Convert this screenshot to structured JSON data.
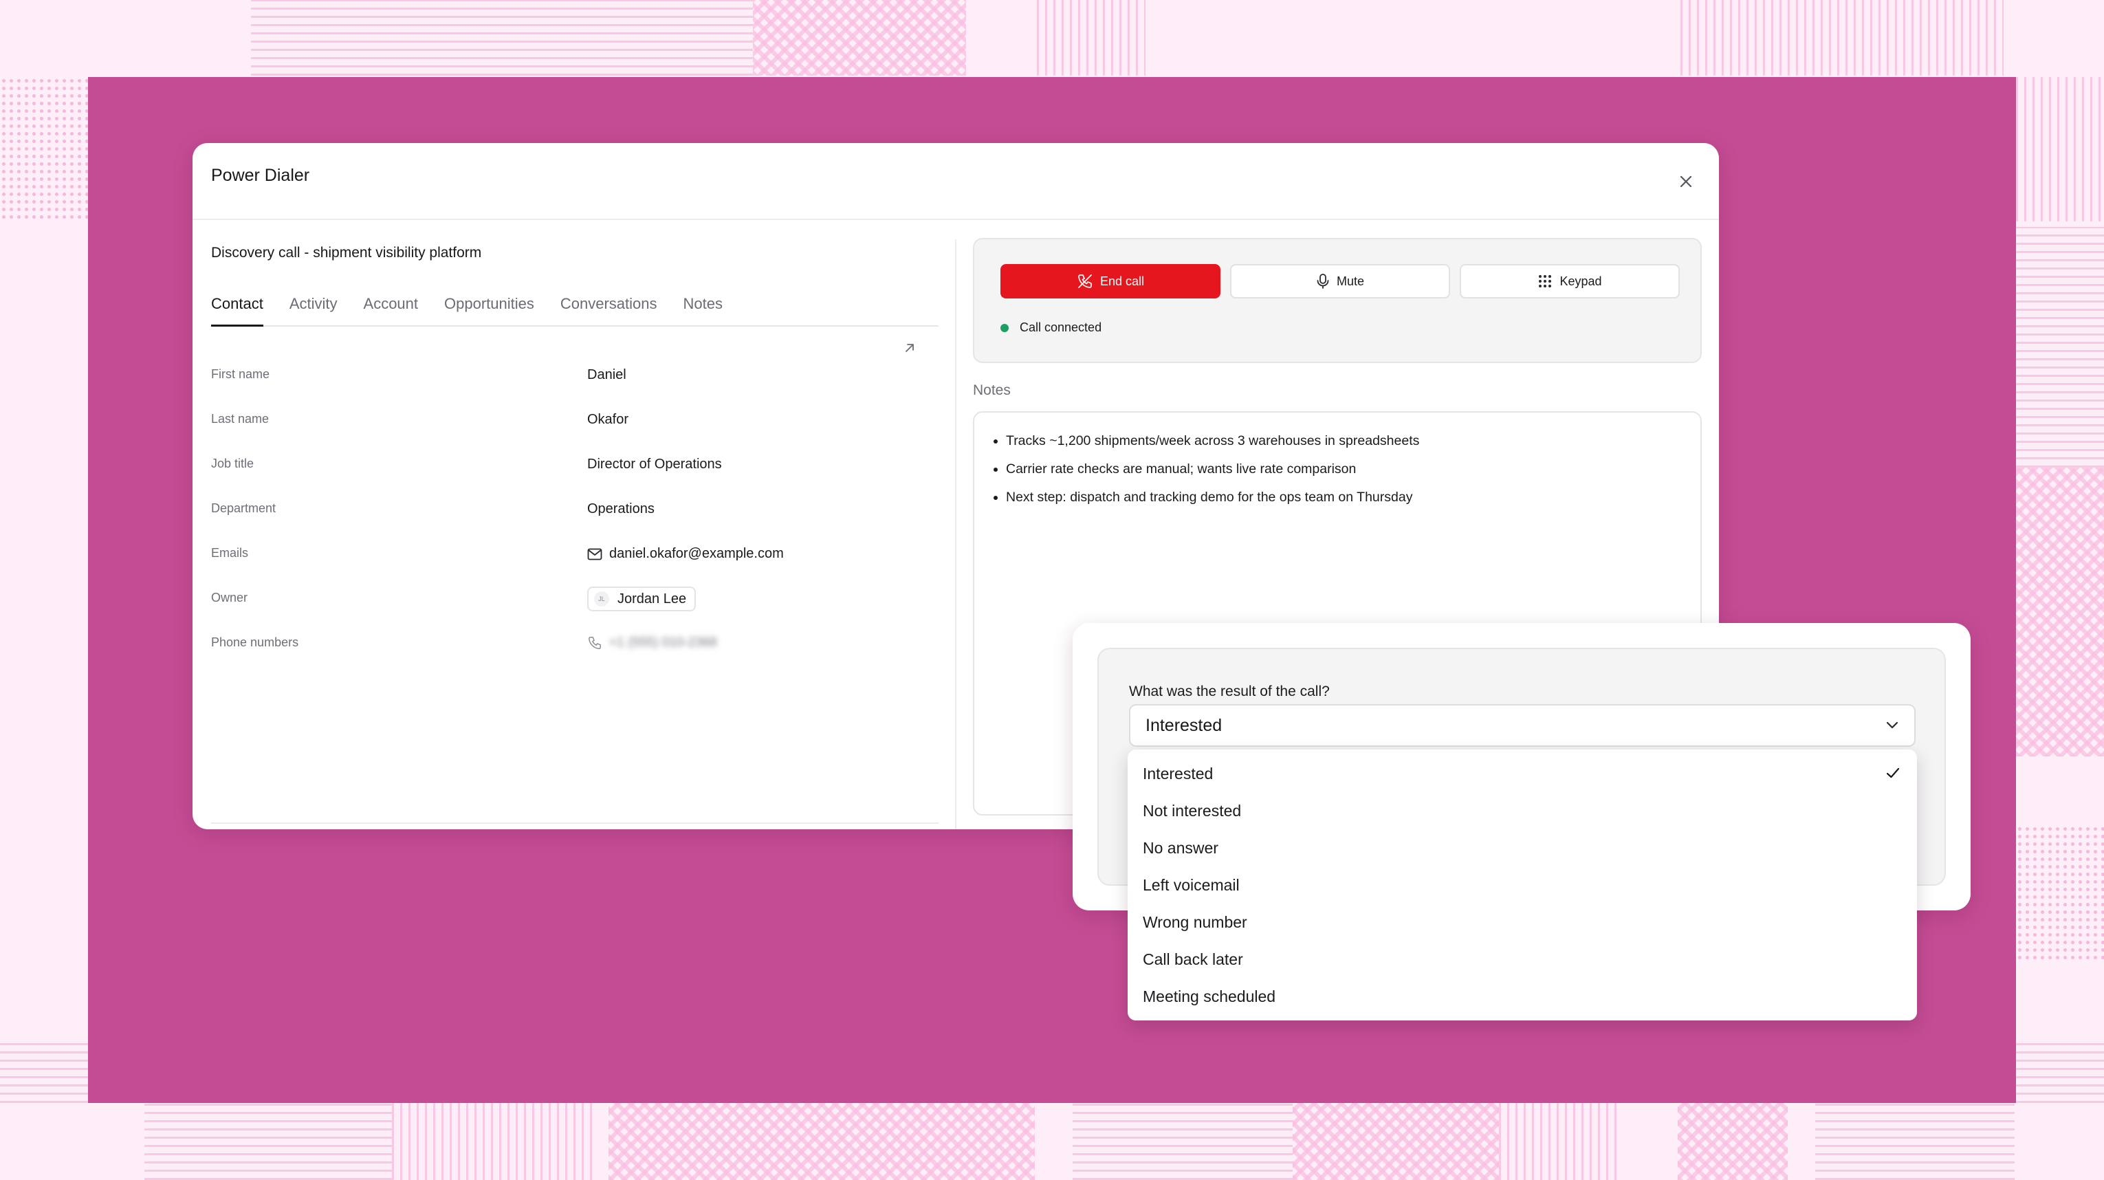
{
  "modal": {
    "title": "Power Dialer",
    "record_title": "Discovery call - shipment visibility platform",
    "tabs": [
      {
        "label": "Contact",
        "active": true
      },
      {
        "label": "Activity",
        "active": false
      },
      {
        "label": "Account",
        "active": false
      },
      {
        "label": "Opportunities",
        "active": false
      },
      {
        "label": "Conversations",
        "active": false
      },
      {
        "label": "Notes",
        "active": false
      }
    ],
    "fields": {
      "first_name": {
        "label": "First name",
        "value": "Daniel"
      },
      "last_name": {
        "label": "Last name",
        "value": "Okafor"
      },
      "job_title": {
        "label": "Job title",
        "value": "Director of Operations"
      },
      "department": {
        "label": "Department",
        "value": "Operations"
      },
      "emails": {
        "label": "Emails",
        "value": "daniel.okafor@example.com",
        "icon": "mail-icon"
      },
      "owner": {
        "label": "Owner",
        "value": "Jordan Lee",
        "initials": "JL"
      },
      "phone_numbers": {
        "label": "Phone numbers",
        "value": "+1 (555) 010-2368",
        "icon": "phone-icon",
        "blurred": true
      }
    }
  },
  "call": {
    "end_label": "End call",
    "mute_label": "Mute",
    "keypad_label": "Keypad",
    "status": "Call connected",
    "colors": {
      "end": "#e5161d",
      "connected": "#1e9e62"
    }
  },
  "notes": {
    "label": "Notes",
    "items": [
      "Tracks ~1,200 shipments/week across 3 warehouses in spreadsheets",
      "Carrier rate checks are manual; wants live rate comparison",
      "Next step: dispatch and tracking demo for the ops team on Thursday"
    ]
  },
  "outcome": {
    "question": "What was the result of the call?",
    "selected": "Interested",
    "options": [
      "Interested",
      "Not interested",
      "No answer",
      "Left voicemail",
      "Wrong number",
      "Call back later",
      "Meeting scheduled"
    ]
  },
  "theme": {
    "background": "#c44c94",
    "page": "#fdeef8"
  }
}
